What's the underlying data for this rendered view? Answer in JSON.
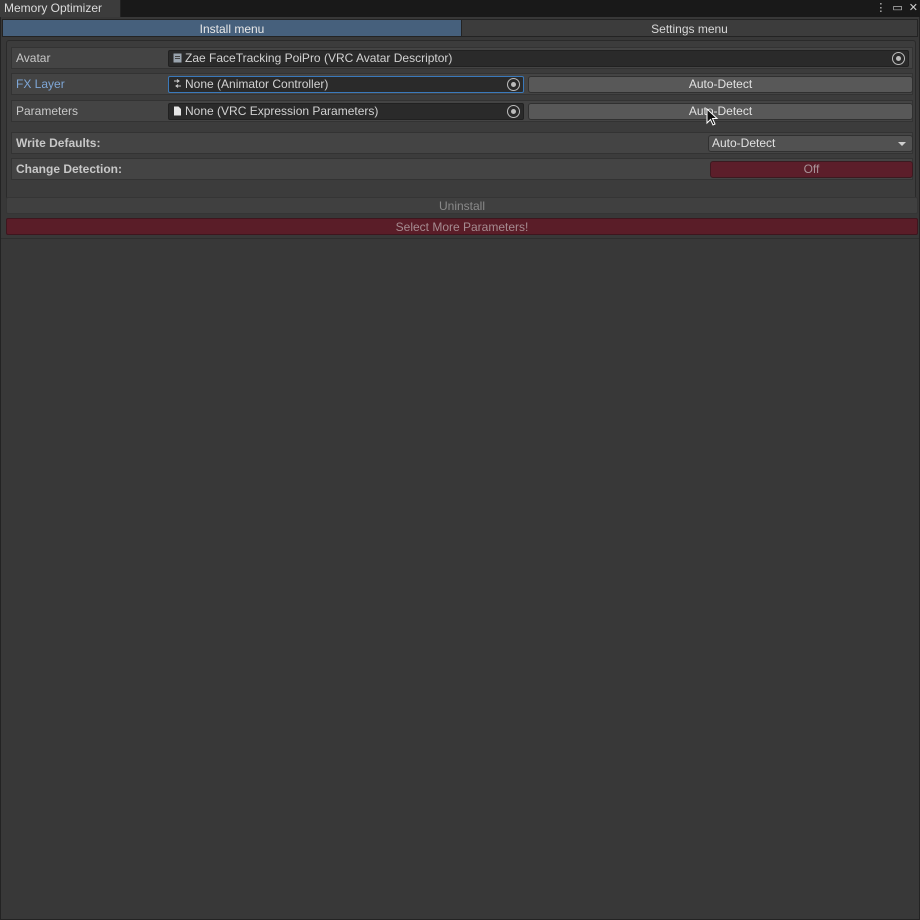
{
  "window": {
    "title": "Memory Optimizer",
    "icons": [
      "kebab-menu-icon",
      "maximize-icon",
      "close-icon"
    ]
  },
  "tabs": [
    {
      "label": "Install menu",
      "active": true
    },
    {
      "label": "Settings menu",
      "active": false
    }
  ],
  "fields": {
    "avatar": {
      "label": "Avatar",
      "value": "Zae FaceTracking PoiPro (VRC Avatar Descriptor)"
    },
    "fx_layer": {
      "label": "FX Layer",
      "value": "None (Animator Controller)",
      "button": "Auto-Detect"
    },
    "parameters": {
      "label": "Parameters",
      "value": "None (VRC Expression Parameters)",
      "button": "Auto-Detect"
    },
    "write_defaults": {
      "label": "Write Defaults:",
      "value": "Auto-Detect"
    },
    "change_detection": {
      "label": "Change Detection:",
      "value": "Off"
    }
  },
  "actions": {
    "uninstall": "Uninstall",
    "warning": "Select More Parameters!"
  },
  "colors": {
    "accent": "#46607c",
    "warning": "#5a1d28",
    "background": "#383838"
  }
}
